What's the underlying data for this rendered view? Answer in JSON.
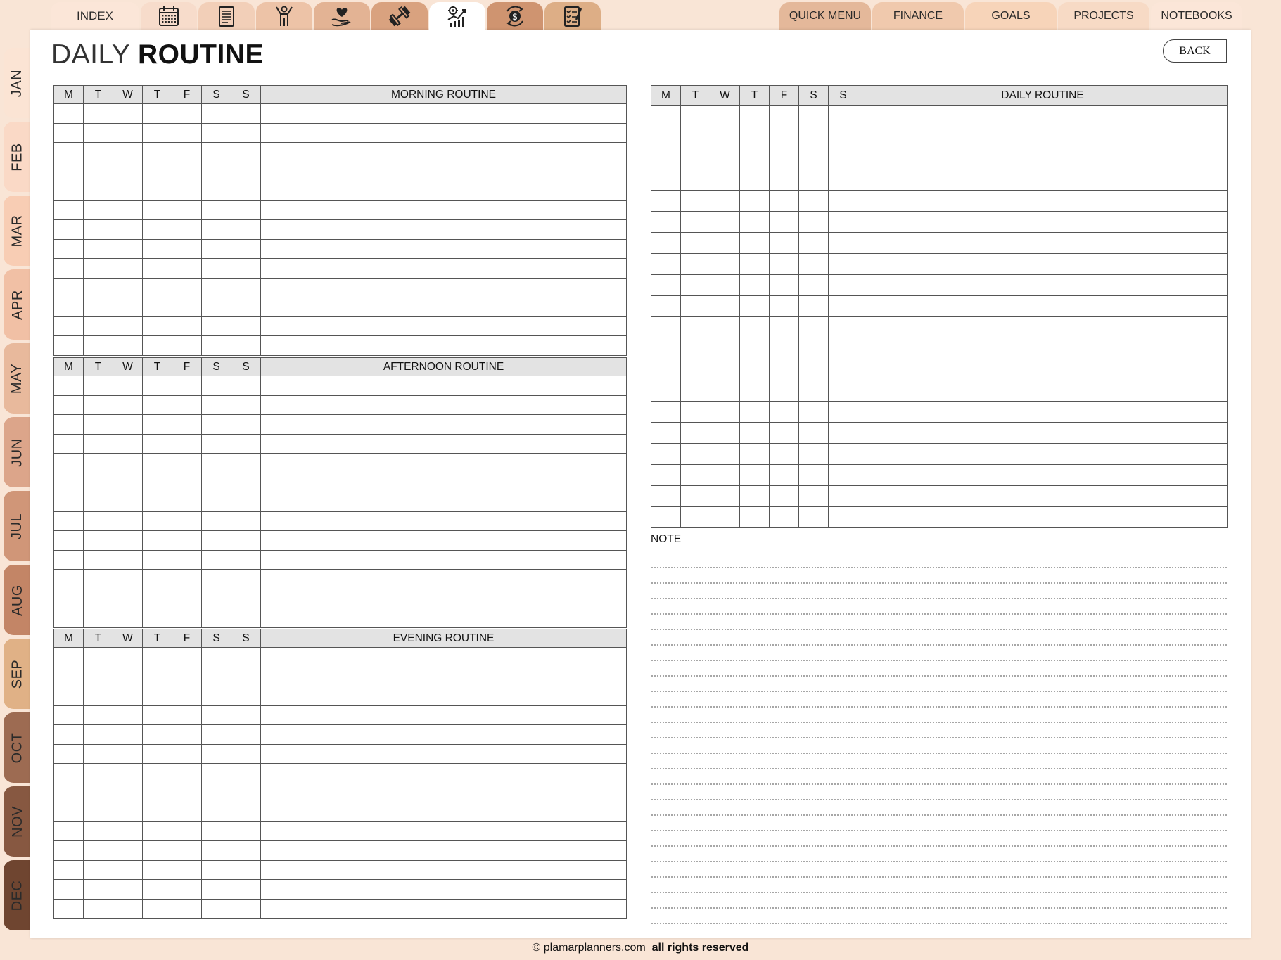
{
  "top_tabs": [
    {
      "name": "tab-index",
      "label": "INDEX",
      "width": 126,
      "color": "#fbe6d8"
    },
    {
      "name": "tab-calendar",
      "icon": "calendar-icon",
      "width": 80,
      "color": "#f7dccb"
    },
    {
      "name": "tab-notes",
      "icon": "notebook-icon",
      "width": 80,
      "color": "#f2cfb8"
    },
    {
      "name": "tab-wellness",
      "icon": "person-icon",
      "width": 80,
      "color": "#edc3a7"
    },
    {
      "name": "tab-selfcare",
      "icon": "heart-hand-icon",
      "width": 80,
      "color": "#e3b394"
    },
    {
      "name": "tab-fitness",
      "icon": "dumbbell-icon",
      "width": 80,
      "color": "#d9a27f"
    },
    {
      "name": "tab-routine",
      "icon": "gear-chart-icon",
      "width": 80,
      "color": "#ffffff",
      "active": true
    },
    {
      "name": "tab-money",
      "icon": "money-cycle-icon",
      "width": 80,
      "color": "#cf9470"
    },
    {
      "name": "tab-checklist",
      "icon": "checklist-icon",
      "width": 80,
      "color": "#ddae86"
    }
  ],
  "right_tabs": [
    {
      "name": "quick-menu",
      "label": "QUICK MENU",
      "width": 130,
      "color": "#e4b89a"
    },
    {
      "name": "finance",
      "label": "FINANCE",
      "width": 130,
      "color": "#f0c9ad"
    },
    {
      "name": "goals",
      "label": "GOALS",
      "width": 130,
      "color": "#f7d4b9"
    },
    {
      "name": "projects",
      "label": "PROJECTS",
      "width": 130,
      "color": "#f7dac5"
    },
    {
      "name": "notebooks",
      "label": "NOTEBOOKS",
      "width": 130,
      "color": "#fbe6d8"
    }
  ],
  "months": [
    {
      "label": "JAN",
      "color": "#fbe4d4"
    },
    {
      "label": "FEB",
      "color": "#fad9c6"
    },
    {
      "label": "MAR",
      "color": "#f8cdb4"
    },
    {
      "label": "APR",
      "color": "#f1c0a5"
    },
    {
      "label": "MAY",
      "color": "#e8b99c"
    },
    {
      "label": "JUN",
      "color": "#dca58a"
    },
    {
      "label": "JUL",
      "color": "#d09678"
    },
    {
      "label": "AUG",
      "color": "#c38566"
    },
    {
      "label": "SEP",
      "color": "#e0b186"
    },
    {
      "label": "OCT",
      "color": "#9d6b52"
    },
    {
      "label": "NOV",
      "color": "#875841"
    },
    {
      "label": "DEC",
      "color": "#6f4530"
    }
  ],
  "page": {
    "title_light": "DAILY ",
    "title_bold": "ROUTINE",
    "back_label": "BACK"
  },
  "days": [
    "M",
    "T",
    "W",
    "T",
    "F",
    "S",
    "S"
  ],
  "sections": [
    {
      "name": "morning-routine-table",
      "title": "MORNING ROUTINE",
      "rows": 13
    },
    {
      "name": "afternoon-routine-table",
      "title": "AFTERNOON ROUTINE",
      "rows": 13
    },
    {
      "name": "evening-routine-table",
      "title": "EVENING ROUTINE",
      "rows": 14
    },
    {
      "name": "daily-routine-table",
      "title": "DAILY ROUTINE",
      "rows": 20
    }
  ],
  "note": {
    "label": "NOTE",
    "lines": 24
  },
  "footer": {
    "copyright": "© plamarplanners.com",
    "rights": "all rights reserved"
  }
}
